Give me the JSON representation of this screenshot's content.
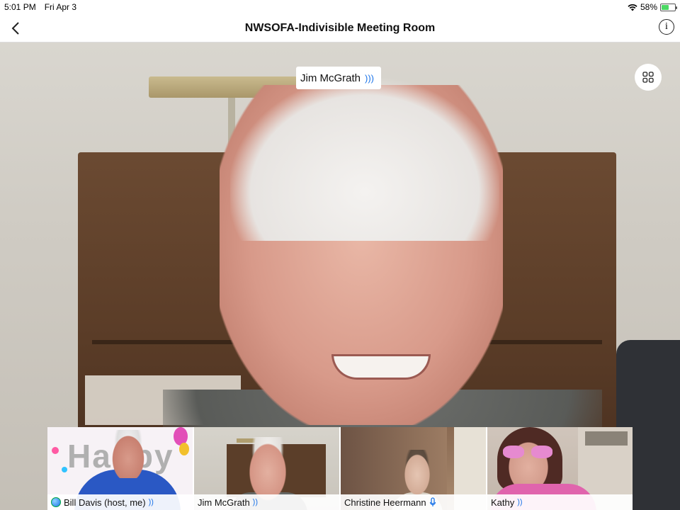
{
  "status_bar": {
    "time": "5:01 PM",
    "date": "Fri Apr 3",
    "battery_percent": "58%",
    "battery_level": 0.58,
    "icons": [
      "wifi-icon",
      "battery-icon"
    ]
  },
  "nav": {
    "title": "NWSOFA-Indivisible Meeting Room",
    "back_icon": "chevron-left-icon",
    "info_label": "i"
  },
  "main_video": {
    "speaker_name": "Jim McGrath",
    "speaker_audio_icon": "speaking-icon",
    "gallery_icon": "gallery-view-icon"
  },
  "participants": [
    {
      "name": "Bill Davis (host, me)",
      "status_icon": "speaking-icon",
      "host_badge": true
    },
    {
      "name": "Jim McGrath",
      "status_icon": "speaking-icon"
    },
    {
      "name": "Christine Heermann",
      "status_icon": "mic-icon"
    },
    {
      "name": "Kathy",
      "status_icon": "speaking-icon"
    }
  ],
  "thumbnail_overlay_text": "Happy",
  "colors": {
    "accent_blue": "#1a73e8",
    "battery_green": "#4cd964",
    "bar_background": "#ffffff"
  }
}
